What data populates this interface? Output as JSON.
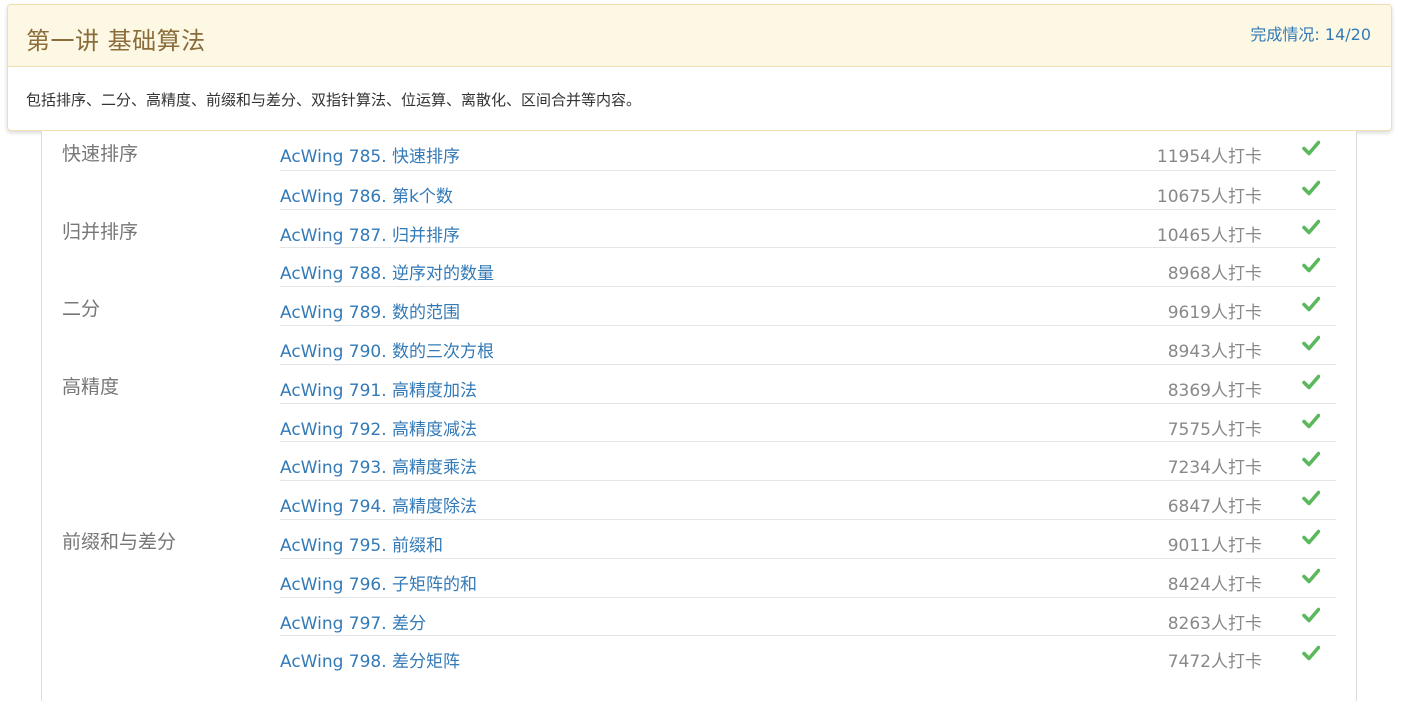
{
  "section": {
    "title": "第一讲 基础算法",
    "progress_label": "完成情况:",
    "progress_value": "14/20",
    "description": "包括排序、二分、高精度、前缀和与差分、双指针算法、位运算、离散化、区间合并等内容。"
  },
  "colors": {
    "link": "#337ab7",
    "check": "#5cb85c",
    "heading_bg": "#fcf8e3",
    "heading_text": "#8a6d3b"
  },
  "groups": [
    {
      "name": "快速排序",
      "problems": [
        {
          "title": "AcWing 785. 快速排序",
          "count": "11954人打卡",
          "status": "done"
        },
        {
          "title": "AcWing 786. 第k个数",
          "count": "10675人打卡",
          "status": "done"
        }
      ]
    },
    {
      "name": "归并排序",
      "problems": [
        {
          "title": "AcWing 787. 归并排序",
          "count": "10465人打卡",
          "status": "done"
        },
        {
          "title": "AcWing 788. 逆序对的数量",
          "count": "8968人打卡",
          "status": "done"
        }
      ]
    },
    {
      "name": "二分",
      "problems": [
        {
          "title": "AcWing 789. 数的范围",
          "count": "9619人打卡",
          "status": "done"
        },
        {
          "title": "AcWing 790. 数的三次方根",
          "count": "8943人打卡",
          "status": "done"
        }
      ]
    },
    {
      "name": "高精度",
      "problems": [
        {
          "title": "AcWing 791. 高精度加法",
          "count": "8369人打卡",
          "status": "done"
        },
        {
          "title": "AcWing 792. 高精度减法",
          "count": "7575人打卡",
          "status": "done"
        },
        {
          "title": "AcWing 793. 高精度乘法",
          "count": "7234人打卡",
          "status": "done"
        },
        {
          "title": "AcWing 794. 高精度除法",
          "count": "6847人打卡",
          "status": "done"
        }
      ]
    },
    {
      "name": "前缀和与差分",
      "problems": [
        {
          "title": "AcWing 795. 前缀和",
          "count": "9011人打卡",
          "status": "done"
        },
        {
          "title": "AcWing 796. 子矩阵的和",
          "count": "8424人打卡",
          "status": "done"
        },
        {
          "title": "AcWing 797. 差分",
          "count": "8263人打卡",
          "status": "done"
        },
        {
          "title": "AcWing 798. 差分矩阵",
          "count": "7472人打卡",
          "status": "done"
        }
      ]
    }
  ]
}
